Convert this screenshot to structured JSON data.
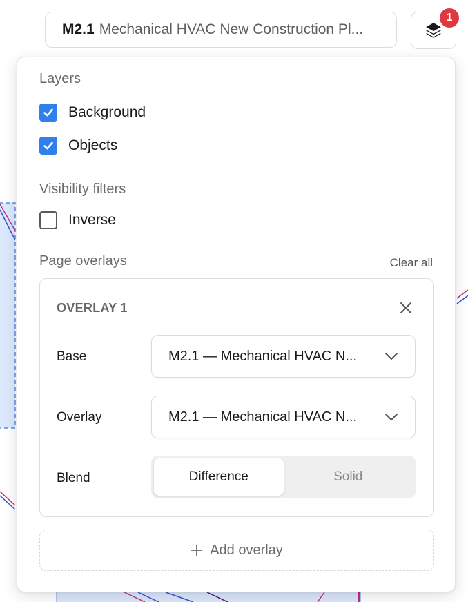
{
  "sheet": {
    "code": "M2.1",
    "name": "Mechanical HVAC New Construction Pl..."
  },
  "layers_button": {
    "icon": "layers-icon",
    "badge_count": "1",
    "badge_color": "#e0383e"
  },
  "panel": {
    "layers": {
      "title": "Layers",
      "items": [
        {
          "label": "Background",
          "checked": true
        },
        {
          "label": "Objects",
          "checked": true
        }
      ]
    },
    "visibility_filters": {
      "title": "Visibility filters",
      "items": [
        {
          "label": "Inverse",
          "checked": false
        }
      ]
    },
    "page_overlays": {
      "title": "Page overlays",
      "clear_all": "Clear all",
      "overlays": [
        {
          "heading": "OVERLAY 1",
          "base_label": "Base",
          "base_value": "M2.1 — Mechanical HVAC N...",
          "overlay_label": "Overlay",
          "overlay_value": "M2.1 — Mechanical HVAC N...",
          "blend_label": "Blend",
          "blend_options": [
            "Difference",
            "Solid"
          ],
          "blend_selected": "Difference"
        }
      ],
      "add_overlay": "Add overlay"
    }
  },
  "colors": {
    "accent": "#2f80ed",
    "badge": "#e0383e"
  }
}
